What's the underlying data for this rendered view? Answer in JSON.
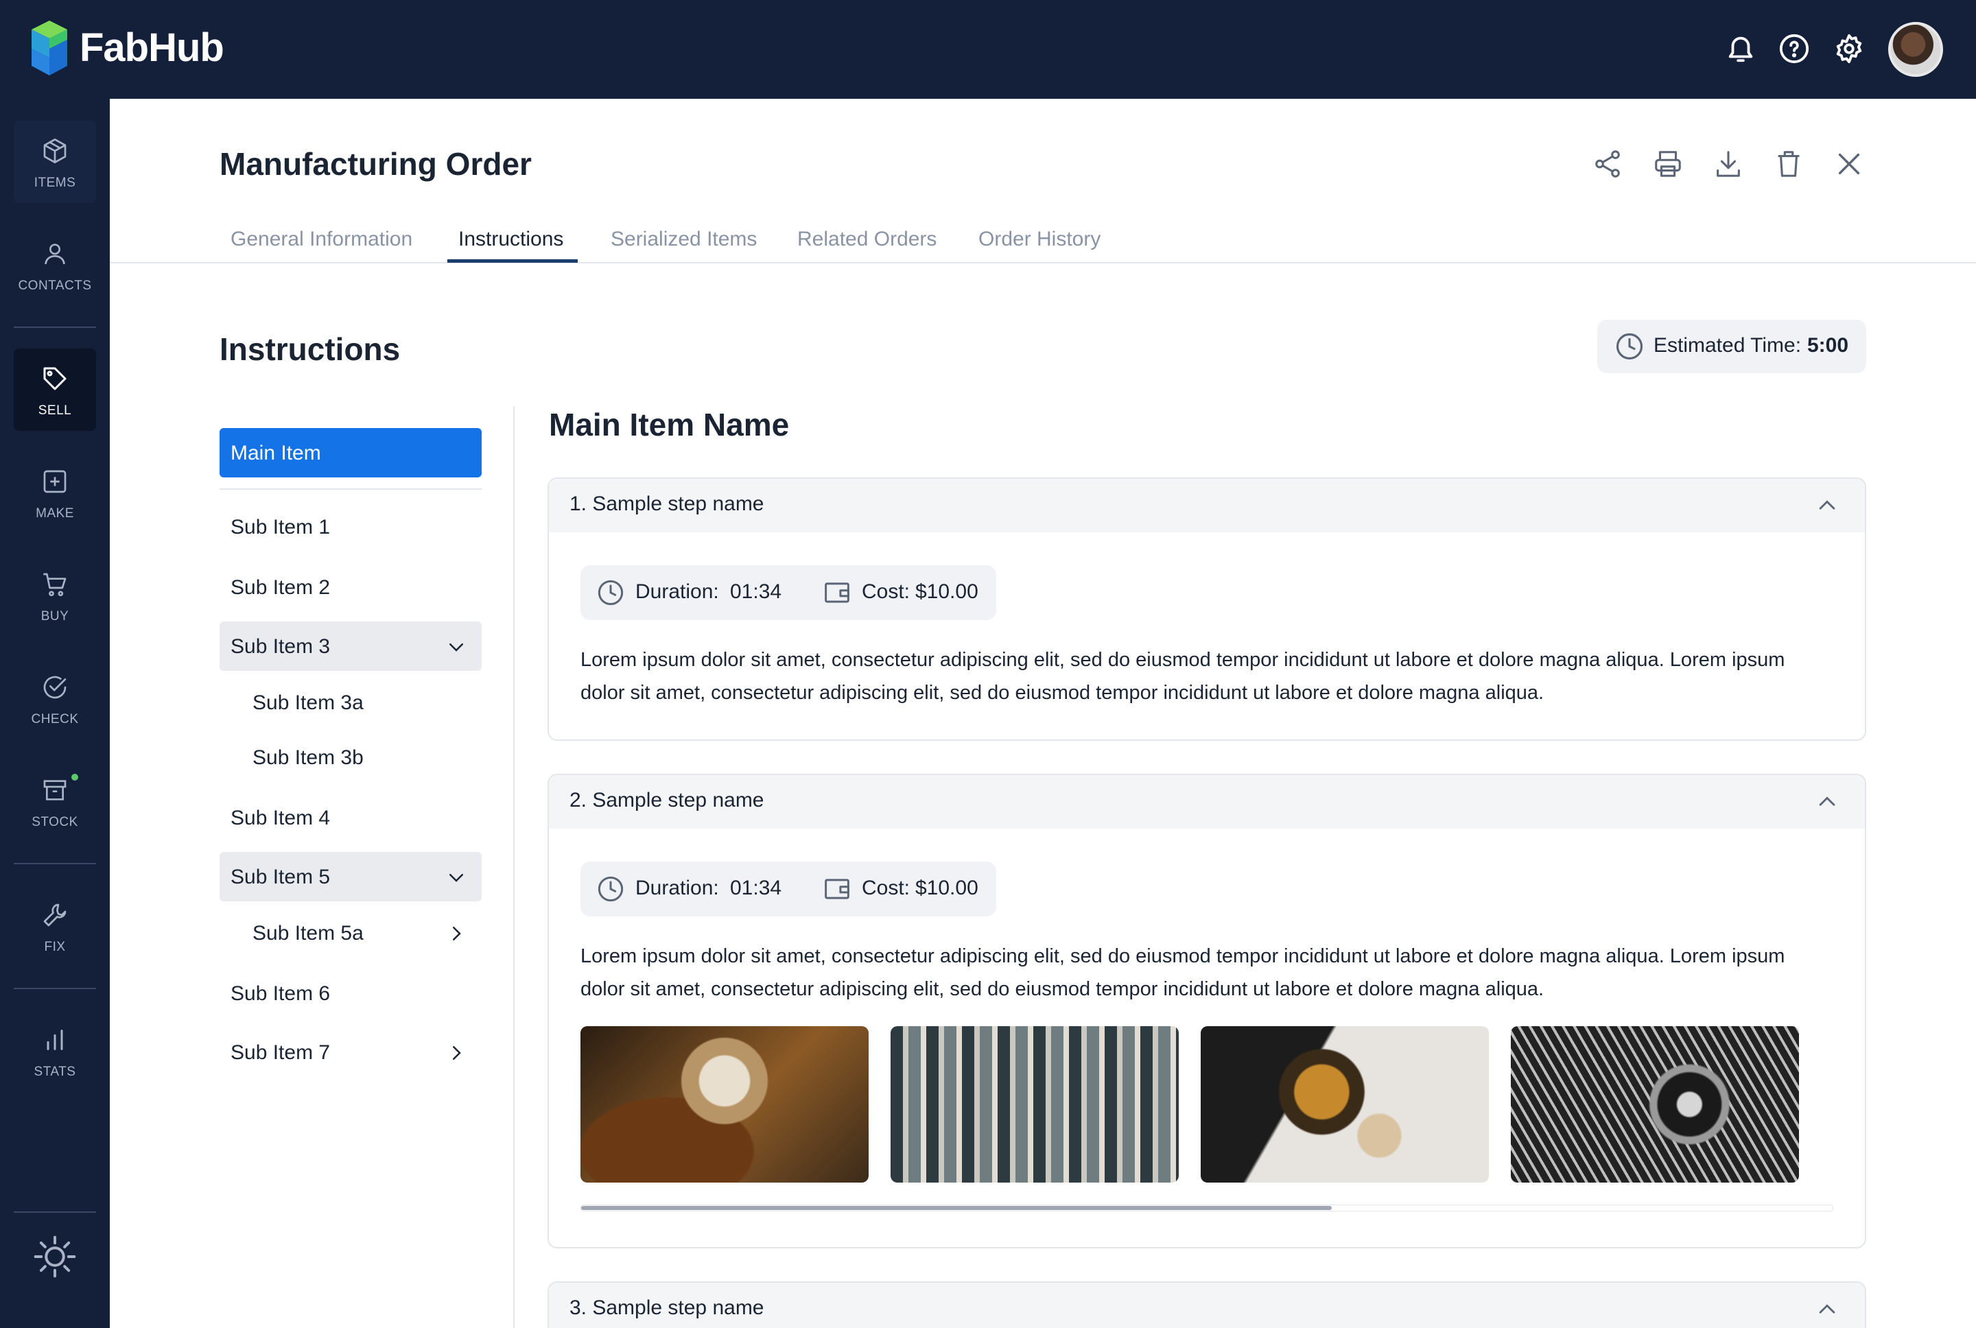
{
  "app": {
    "brand": "FabHub",
    "accent": "#1473e6",
    "nav_bg": "#141f3a"
  },
  "topbar": {
    "icons": [
      "bell-icon",
      "help-icon",
      "gear-icon"
    ],
    "avatar": "user-avatar"
  },
  "sidebar": {
    "items": [
      {
        "label": "ITEMS",
        "icon": "box-icon"
      },
      {
        "label": "CONTACTS",
        "icon": "person-icon"
      },
      {
        "label": "SELL",
        "icon": "tag-icon",
        "active": true
      },
      {
        "label": "MAKE",
        "icon": "plus-square-icon"
      },
      {
        "label": "BUY",
        "icon": "cart-icon"
      },
      {
        "label": "CHECK",
        "icon": "check-circle-icon"
      },
      {
        "label": "STOCK",
        "icon": "archive-icon",
        "status_dot": "#5cc96a"
      },
      {
        "label": "FIX",
        "icon": "wrench-icon"
      },
      {
        "label": "STATS",
        "icon": "bar-chart-icon"
      }
    ],
    "bottom_icon": "sun-icon"
  },
  "header": {
    "title": "Manufacturing Order",
    "actions": [
      "share-icon",
      "print-icon",
      "download-icon",
      "trash-icon",
      "close-icon"
    ],
    "tabs": [
      {
        "label": "General Information"
      },
      {
        "label": "Instructions",
        "active": true
      },
      {
        "label": "Serialized Items"
      },
      {
        "label": "Related Orders"
      },
      {
        "label": "Order History"
      }
    ]
  },
  "instructions": {
    "title": "Instructions",
    "estimated_label": "Estimated Time:",
    "estimated_value": "5:00"
  },
  "tree": {
    "items": [
      {
        "label": "Main Item",
        "selected": true
      },
      {
        "label": "Sub Item 1"
      },
      {
        "label": "Sub Item 2"
      },
      {
        "label": "Sub Item 3",
        "expanded": true
      },
      {
        "label": "Sub Item 3a",
        "level": 2
      },
      {
        "label": "Sub Item 3b",
        "level": 2
      },
      {
        "label": "Sub Item 4"
      },
      {
        "label": "Sub Item 5",
        "expanded": true
      },
      {
        "label": "Sub Item 5a",
        "level": 2,
        "has_children": true
      },
      {
        "label": "Sub Item 6"
      },
      {
        "label": "Sub Item 7",
        "has_children": true
      }
    ]
  },
  "main": {
    "item_name": "Main Item Name",
    "steps": [
      {
        "title": "1. Sample step name",
        "duration_label": "Duration:",
        "duration": "01:34",
        "cost_label": "Cost:",
        "cost": "$10.00",
        "text": "Lorem ipsum dolor sit amet, consectetur adipiscing elit, sed do eiusmod tempor incididunt ut labore et dolore magna aliqua. Lorem ipsum dolor sit amet, consectetur adipiscing elit, sed do eiusmod tempor incididunt ut labore et dolore magna aliqua."
      },
      {
        "title": "2. Sample step name",
        "duration_label": "Duration:",
        "duration": "01:34",
        "cost_label": "Cost:",
        "cost": "$10.00",
        "text": "Lorem ipsum dolor sit amet, consectetur adipiscing elit, sed do eiusmod tempor incididunt ut labore et dolore magna aliqua. Lorem ipsum dolor sit amet, consectetur adipiscing elit, sed do eiusmod tempor incididunt ut labore et dolore magna aliqua.",
        "images": [
          "vintage-machine-photo",
          "circuit-board-photo",
          "watch-gears-photo",
          "engine-gears-photo"
        ],
        "gallery_scroll_fraction": 0.4
      },
      {
        "title": "3. Sample step name"
      }
    ]
  }
}
